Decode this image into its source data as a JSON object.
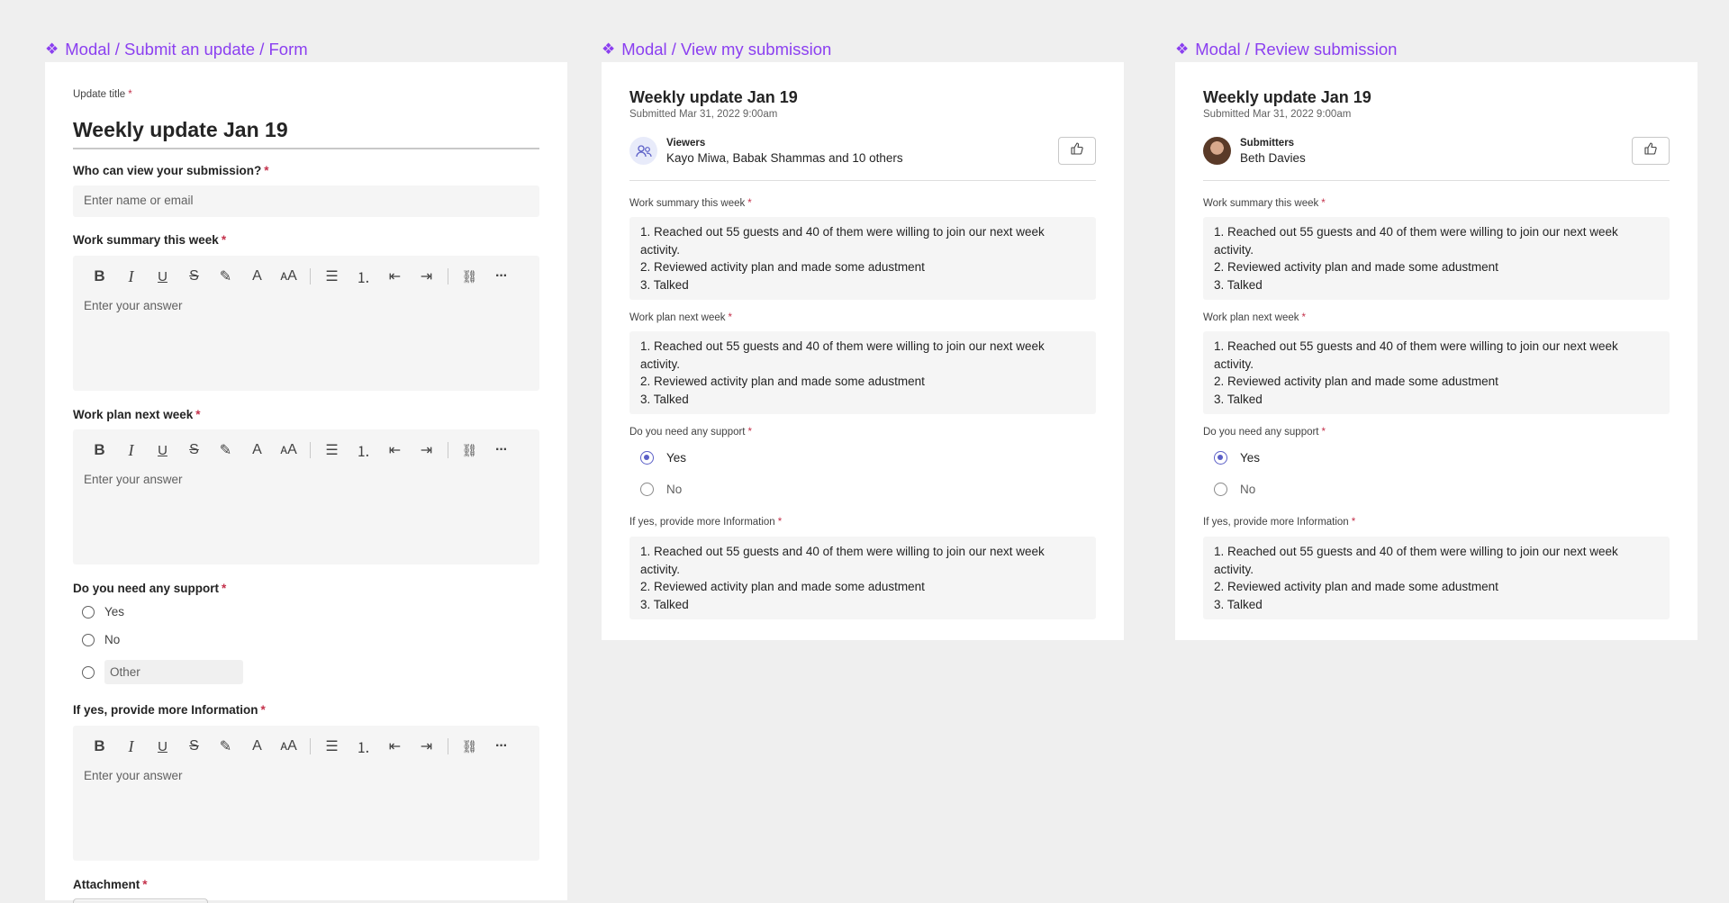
{
  "frames": {
    "form": "Modal / Submit an update / Form",
    "view": "Modal / View my submission",
    "review": "Modal / Review submission"
  },
  "form": {
    "title_label": "Update title",
    "title_value": "Weekly update Jan 19",
    "viewers_label": "Who can view your submission?",
    "viewers_placeholder": "Enter name or email",
    "summary_label": "Work summary this week",
    "plan_label": "Work plan next week",
    "answer_placeholder": "Enter your answer",
    "support_label": "Do you need any support",
    "support_options": [
      "Yes",
      "No",
      "Other"
    ],
    "info_label": "If yes, provide more Information",
    "attachment_label": "Attachment",
    "required_mark": "*"
  },
  "view": {
    "title": "Weekly update Jan 19",
    "submitted": "Submitted Mar 31, 2022 9:00am",
    "people_label": "Viewers",
    "people_names": "Kayo Miwa, Babak Shammas and 10 others"
  },
  "review": {
    "title": "Weekly update Jan 19",
    "submitted": "Submitted Mar 31, 2022 9:00am",
    "people_label": "Submitters",
    "people_names": "Beth Davies"
  },
  "answers": {
    "summary_label": "Work summary this week",
    "plan_label": "Work plan next week",
    "support_label": "Do you need any support",
    "info_label": "If yes, provide more Information",
    "line1": "1. Reached out 55 guests and 40 of them were willing to join our next week activity.",
    "line2": "2. Reviewed activity plan and made some adustment",
    "line3": "3. Talked",
    "yes": "Yes",
    "no": "No",
    "selected": "Yes"
  },
  "toolbar_icons": [
    "bold-icon",
    "italic-icon",
    "underline-icon",
    "strikethrough-icon",
    "highlight-icon",
    "font-color-icon",
    "font-size-icon",
    "bullet-list-icon",
    "numbered-list-icon",
    "decrease-indent-icon",
    "increase-indent-icon",
    "link-icon",
    "more-icon"
  ],
  "colors": {
    "accent": "#5b5fc7",
    "frame_label": "#8b3ff0",
    "required": "#c4314b"
  }
}
